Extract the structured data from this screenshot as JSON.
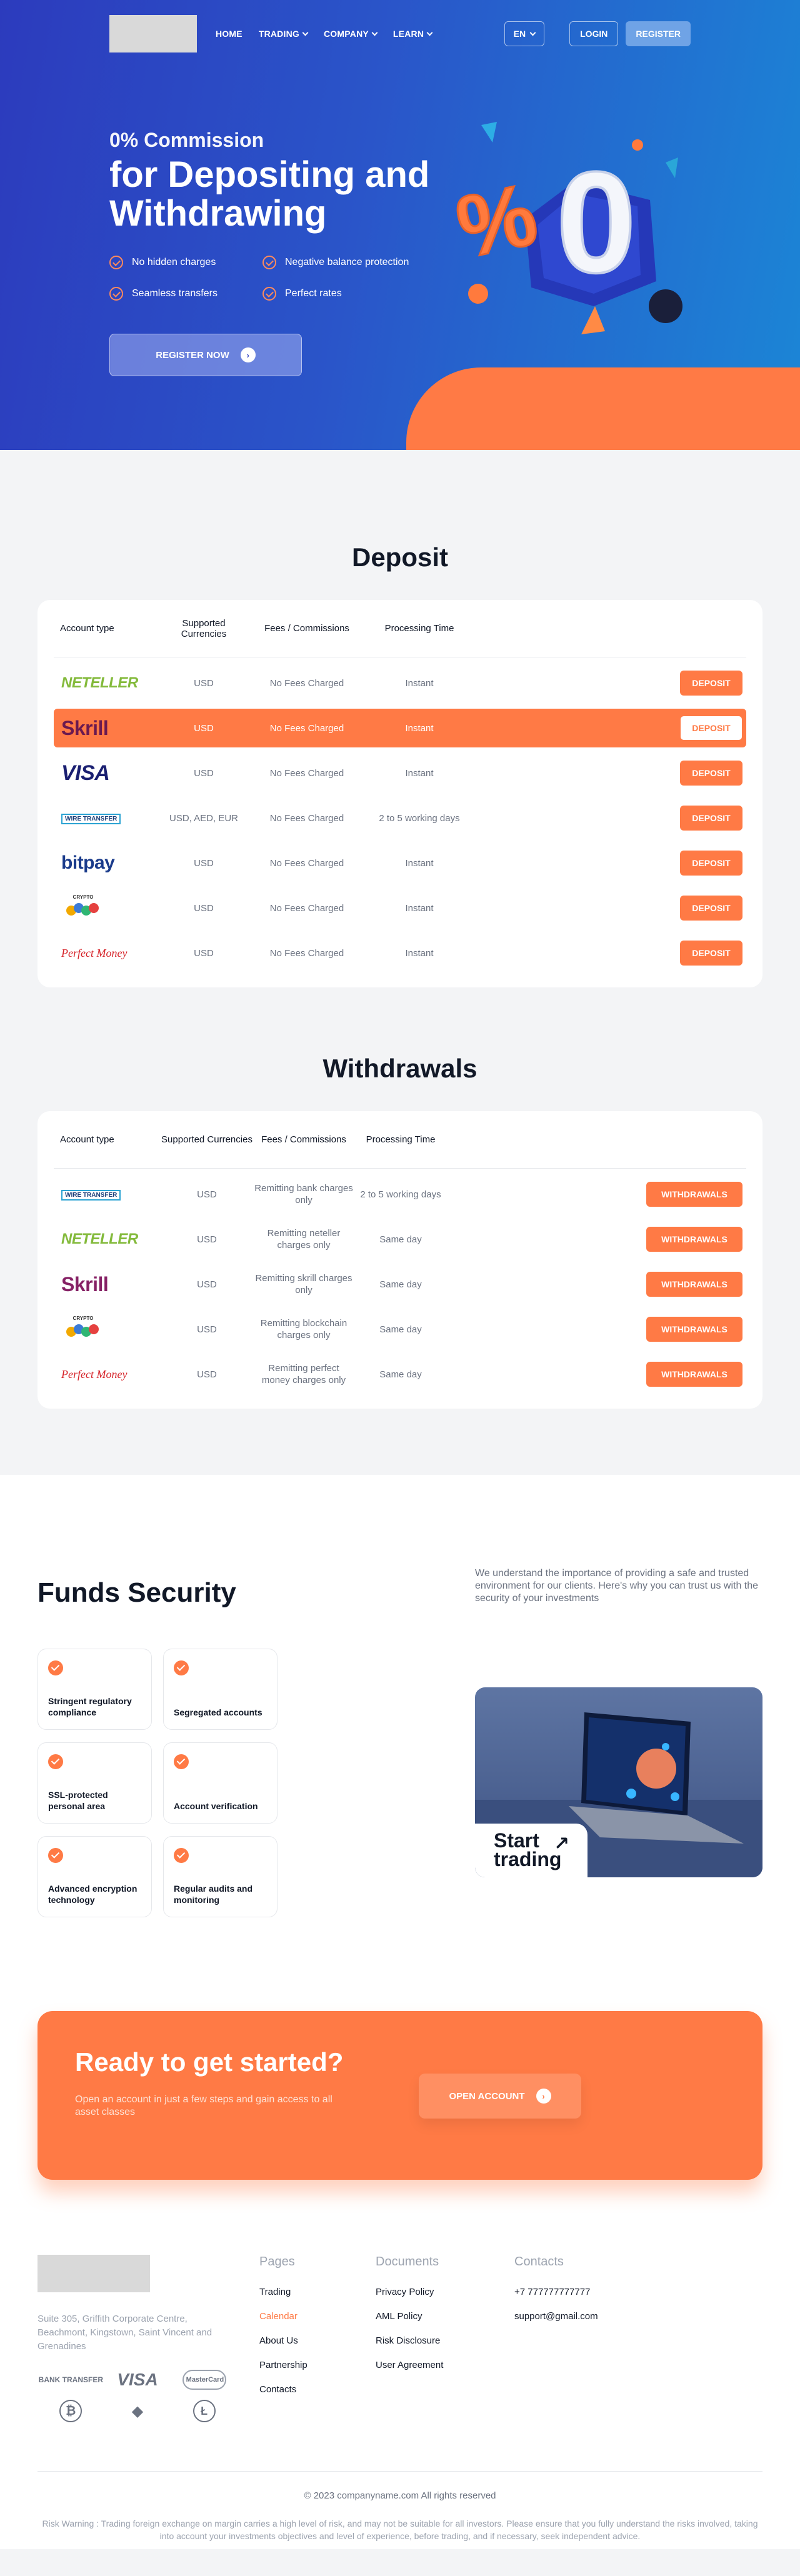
{
  "nav": {
    "items": [
      {
        "label": "HOME",
        "dropdown": false
      },
      {
        "label": "TRADING",
        "dropdown": true
      },
      {
        "label": "COMPANY",
        "dropdown": true
      },
      {
        "label": "LEARN",
        "dropdown": true
      }
    ],
    "lang": "EN",
    "login": "LOGIN",
    "register": "REGISTER"
  },
  "hero": {
    "subtitle": "0% Commission",
    "title": "for Depositing and Withdrawing",
    "features": [
      "No hidden charges",
      "Negative balance protection",
      "Seamless transfers",
      "Perfect rates"
    ],
    "cta": "REGISTER NOW",
    "art_symbols": [
      "%",
      "0"
    ]
  },
  "deposit": {
    "title": "Deposit",
    "headers": [
      "Account type",
      "Supported Currencies",
      "Fees / Commissions",
      "Processing Time"
    ],
    "rows": [
      {
        "brand": "NETELLER",
        "currency": "USD",
        "fees": "No Fees Charged",
        "time": "Instant",
        "button": "DEPOSIT"
      },
      {
        "brand": "Skrill",
        "currency": "USD",
        "fees": "No Fees Charged",
        "time": "Instant",
        "button": "DEPOSIT",
        "highlight": true
      },
      {
        "brand": "VISA",
        "currency": "USD",
        "fees": "No Fees Charged",
        "time": "Instant",
        "button": "DEPOSIT"
      },
      {
        "brand": "WIRE TRANSFER",
        "currency": "USD, AED, EUR",
        "fees": "No Fees Charged",
        "time": "2 to 5 working days",
        "button": "DEPOSIT"
      },
      {
        "brand": "bitpay",
        "currency": "USD",
        "fees": "No Fees Charged",
        "time": "Instant",
        "button": "DEPOSIT"
      },
      {
        "brand": "CRYPTO",
        "currency": "USD",
        "fees": "No Fees Charged",
        "time": "Instant",
        "button": "DEPOSIT"
      },
      {
        "brand": "Perfect Money",
        "currency": "USD",
        "fees": "No Fees Charged",
        "time": "Instant",
        "button": "DEPOSIT"
      }
    ]
  },
  "withdrawals": {
    "title": "Withdrawals",
    "headers": [
      "Account type",
      "Supported Currencies",
      "Fees / Commissions",
      "Processing Time"
    ],
    "rows": [
      {
        "brand": "WIRE TRANSFER",
        "currency": "USD",
        "fees": "Remitting bank charges only",
        "time": "2 to 5 working days",
        "button": "WITHDRAWALS"
      },
      {
        "brand": "NETELLER",
        "currency": "USD",
        "fees": "Remitting neteller charges only",
        "time": "Same day",
        "button": "WITHDRAWALS"
      },
      {
        "brand": "Skrill",
        "currency": "USD",
        "fees": "Remitting skrill charges only",
        "time": "Same day",
        "button": "WITHDRAWALS"
      },
      {
        "brand": "CRYPTO",
        "currency": "USD",
        "fees": "Remitting blockchain charges only",
        "time": "Same day",
        "button": "WITHDRAWALS"
      },
      {
        "brand": "Perfect Money",
        "currency": "USD",
        "fees": "Remitting perfect money charges only",
        "time": "Same day",
        "button": "WITHDRAWALS"
      }
    ]
  },
  "funds": {
    "title": "Funds Security",
    "description": "We understand the importance of providing a safe and trusted environment for our clients. Here's why you can trust us with the security of your investments",
    "items": [
      "Stringent regulatory compliance",
      "Segregated accounts",
      "SSL-protected personal area",
      "Account verification",
      "Advanced encryption technology",
      "Regular audits and monitoring"
    ],
    "start_label": "Start trading"
  },
  "cta": {
    "title": "Ready to get started?",
    "text": "Open an account in just a few steps and gain access to all asset classes",
    "button": "OPEN ACCOUNT"
  },
  "footer": {
    "address": "Suite 305, Griffith Corporate Centre, Beachmont, Kingstown, Saint Vincent and Grenadines",
    "payment_icons": [
      "BANK TRANSFER",
      "VISA",
      "MasterCard",
      "₿",
      "◆",
      "Ł"
    ],
    "pages": {
      "title": "Pages",
      "links": [
        "Trading",
        "Calendar",
        "About Us",
        "Partnership",
        "Contacts"
      ],
      "active_index": 1
    },
    "documents": {
      "title": "Documents",
      "links": [
        "Privacy Policy",
        "AML Policy",
        "Risk Disclosure",
        "User Agreement"
      ]
    },
    "contacts": {
      "title": "Contacts",
      "links": [
        "+7 777777777777",
        "support@gmail.com"
      ]
    },
    "copyright": "© 2023 companyname.com All rights reserved",
    "risk": "Risk Warning : Trading foreign exchange on margin carries a high level of risk, and may not be suitable for all investors. Please ensure that you fully understand the risks involved, taking into account your investments objectives and level of experience, before trading, and if necessary, seek independent advice."
  },
  "colors": {
    "accent": "#ff7a45",
    "hero_start": "#2c3bbd",
    "hero_end": "#1b86d6",
    "text_dark": "#111827"
  }
}
